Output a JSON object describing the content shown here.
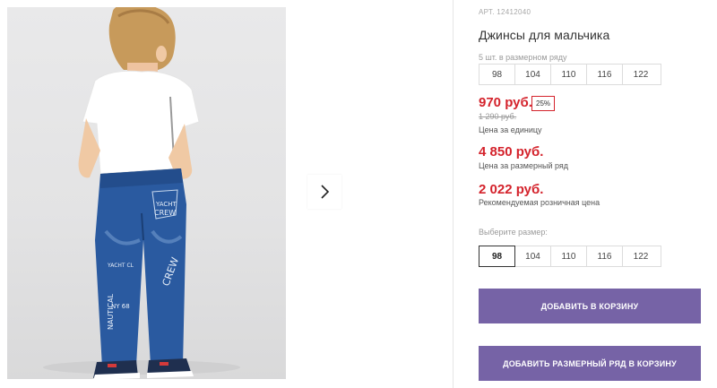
{
  "product": {
    "article": "АРТ. 12412040",
    "title": "Джинсы для мальчика",
    "size_row_caption": "5 шт. в размерном ряду",
    "size_row": [
      "98",
      "104",
      "110",
      "116",
      "122"
    ],
    "price_unit": "970 руб.",
    "discount_badge": "25%",
    "price_old": "1 290 руб.",
    "price_unit_caption": "Цена за единицу",
    "price_row": "4 850 руб.",
    "price_row_caption": "Цена за размерный ряд",
    "price_retail": "2 022 руб.",
    "price_retail_caption": "Рекомендуемая розничная цена",
    "choose_size_label": "Выберите размер:",
    "size_options": [
      "98",
      "104",
      "110",
      "116",
      "122"
    ],
    "selected_size": "98",
    "add_to_cart_label": "ДОБАВИТЬ В КОРЗИНУ",
    "add_row_to_cart_label": "ДОБАВИТЬ РАЗМЕРНЫЙ РЯД В КОРЗИНУ"
  },
  "gallery": {
    "next_icon": "chevron-right-icon",
    "photo_print_words": [
      "YACHT",
      "CREW",
      "NAUTICAL",
      "CREW",
      "YACHT CL",
      "NY 68"
    ]
  },
  "colors": {
    "accent_button": "#7663a6",
    "price_red": "#d4232c",
    "denim": "#2a5aa0"
  }
}
